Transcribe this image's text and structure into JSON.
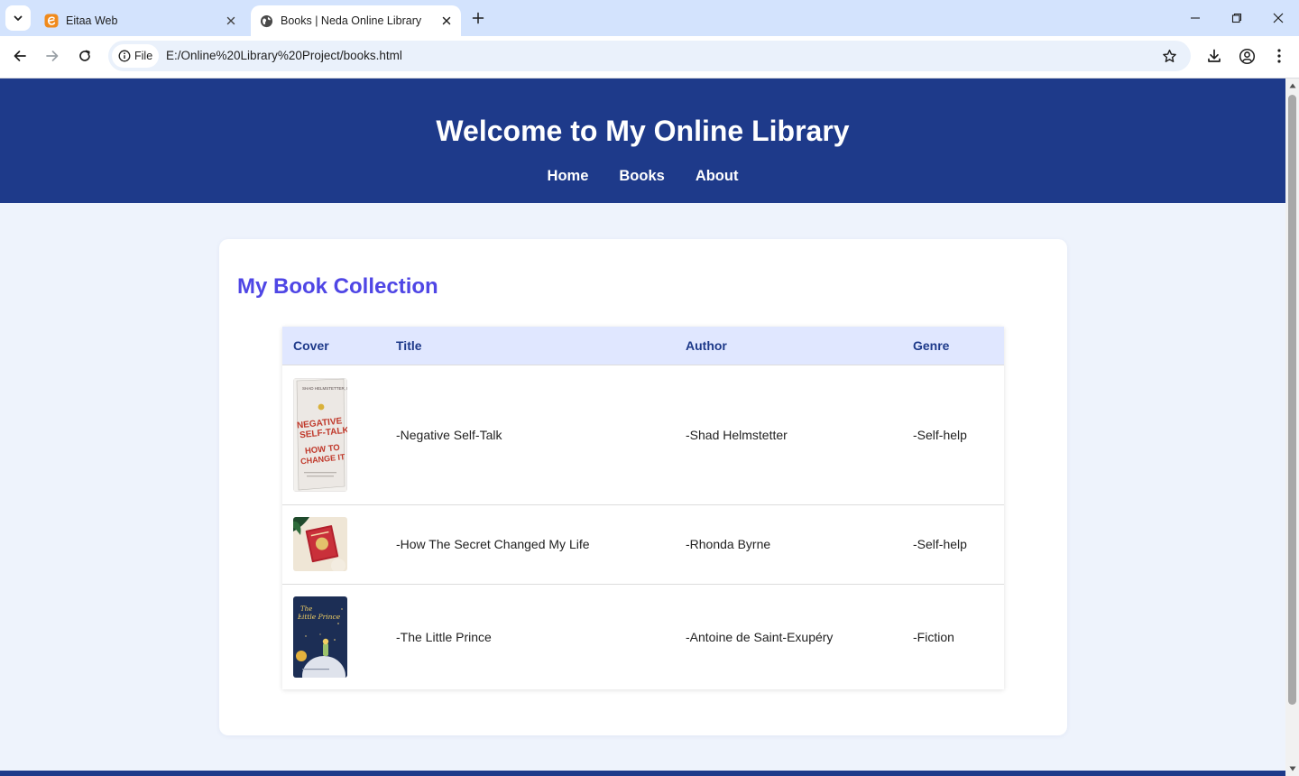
{
  "browser": {
    "tabs": [
      {
        "title": "Eitaa Web",
        "active": false,
        "icon": "eitaa-favicon"
      },
      {
        "title": "Books | Neda Online Library",
        "active": true,
        "icon": "globe-favicon"
      }
    ],
    "omnibox": {
      "chip_label": "File",
      "url": "E:/Online%20Library%20Project/books.html"
    }
  },
  "site": {
    "title": "Welcome to My Online Library",
    "nav": [
      "Home",
      "Books",
      "About"
    ]
  },
  "main": {
    "heading": "My Book Collection",
    "table": {
      "columns": [
        "Cover",
        "Title",
        "Author",
        "Genre"
      ],
      "rows": [
        {
          "cover": "negative-self-talk-cover",
          "title": "-Negative Self-Talk",
          "author": "-Shad Helmstetter",
          "genre": "-Self-help"
        },
        {
          "cover": "how-the-secret-changed-my-life-cover",
          "title": "-How The Secret Changed My Life",
          "author": "-Rhonda Byrne",
          "genre": "-Self-help"
        },
        {
          "cover": "the-little-prince-cover",
          "title": "-The Little Prince",
          "author": "-Antoine de Saint-Exupéry",
          "genre": "-Fiction"
        }
      ]
    },
    "covers": {
      "row0": {
        "lines": [
          "NEGATIVE",
          "SELF-TALK",
          "HOW TO",
          "CHANGE IT"
        ]
      },
      "row2": {
        "lines": [
          "The",
          "Little Prince"
        ]
      }
    }
  },
  "colors": {
    "header_bg": "#1e3a8a",
    "heading": "#4f46e5",
    "table_header_bg": "#e0e7ff",
    "page_bg": "#eef3fc",
    "tabstrip_bg": "#d3e3fd"
  }
}
